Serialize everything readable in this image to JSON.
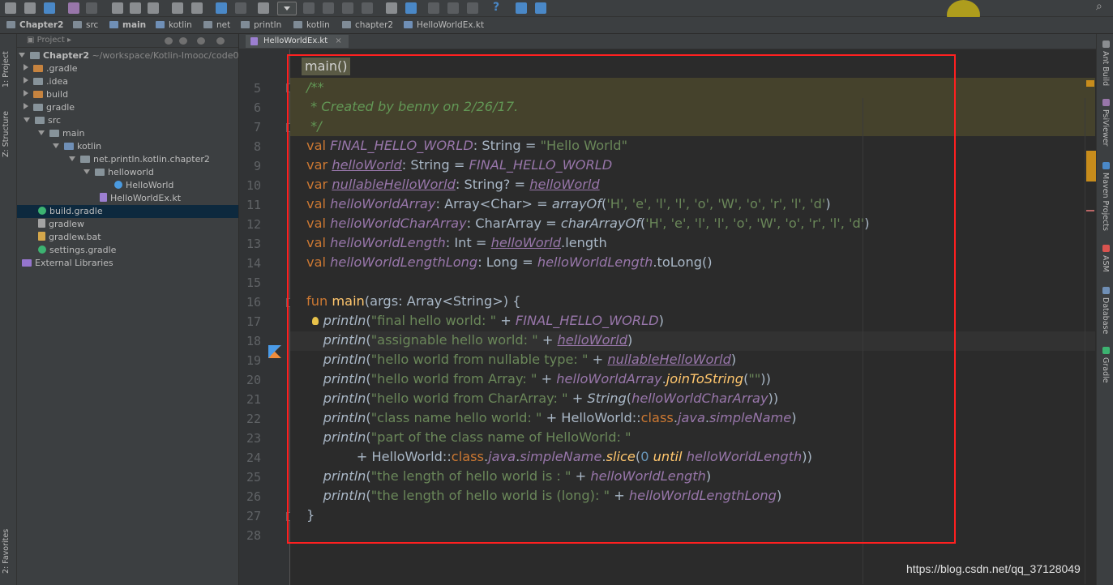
{
  "breadcrumbs": [
    "Chapter2",
    "src",
    "main",
    "kotlin",
    "net",
    "println",
    "kotlin",
    "chapter2",
    "HelloWorldEx.kt"
  ],
  "left_tool_tabs": [
    "1: Project",
    "Z: Structure",
    "2: Favorites"
  ],
  "right_tool_tabs": [
    "Ant Build",
    "PsiViewer",
    "Maven Projects",
    "ASM",
    "Database",
    "Gradle"
  ],
  "project_panel": {
    "title": "Project",
    "root_name": "Chapter2",
    "root_path": "~/workspace/Kotlin-Imooc/code0",
    "items": [
      {
        "label": ".gradle"
      },
      {
        "label": ".idea"
      },
      {
        "label": "build"
      },
      {
        "label": "gradle"
      },
      {
        "label": "src"
      },
      {
        "label": "main"
      },
      {
        "label": "kotlin"
      },
      {
        "label": "net.println.kotlin.chapter2"
      },
      {
        "label": "helloworld"
      },
      {
        "label": "HelloWorld"
      },
      {
        "label": "HelloWorldEx.kt"
      },
      {
        "label": "build.gradle"
      },
      {
        "label": "gradlew"
      },
      {
        "label": "gradlew.bat"
      },
      {
        "label": "settings.gradle"
      },
      {
        "label": "External Libraries"
      }
    ]
  },
  "editor": {
    "tab_label": "HelloWorldEx.kt",
    "tab_close": "×",
    "sticky_header": "main()",
    "line_numbers": [
      "5",
      "6",
      "7",
      "8",
      "9",
      "10",
      "11",
      "12",
      "13",
      "14",
      "15",
      "16",
      "17",
      "18",
      "19",
      "20",
      "21",
      "22",
      "23",
      "24",
      "25",
      "26",
      "27",
      "28"
    ]
  },
  "code_tokens": {
    "c_open": "/**",
    "c_body": " * Created by benny on 2/26/17.",
    "c_close": " */",
    "val": "val",
    "var": "var",
    "fun": "fun",
    "class": "class",
    "until": "until",
    "FINAL_HELLO_WORLD": "FINAL_HELLO_WORLD",
    "helloWorld": "helloWorld",
    "nullableHelloWorld": "nullableHelloWorld",
    "helloWorldArray": "helloWorldArray",
    "helloWorldCharArray": "helloWorldCharArray",
    "helloWorldLength": "helloWorldLength",
    "helloWorldLengthLong": "helloWorldLengthLong",
    "l8_mid": ": String = ",
    "s_hello": "\"Hello World\"",
    "l9_mid": ": String = ",
    "l10_mid": ": String? = ",
    "l11_mid": ": Array<Char> = ",
    "arrayOf": "arrayOf",
    "l12_mid": ": CharArray = ",
    "charArrayOf": "charArrayOf",
    "chars_open": "(",
    "chars_list": "'H', 'e', 'l', 'l', 'o', 'W', 'o', 'r', 'l', 'd'",
    "chars_close": ")",
    "l13_mid": ": Int = ",
    "l13_tail": ".length",
    "l14_mid": ": Long = ",
    "l14_tail": ".toLong()",
    "main": "main",
    "main_sig": "(args: Array<String>) {",
    "println": "println",
    "paren_open": "(",
    "plus": " + ",
    "paren_close": ")",
    "paren_close2": "))",
    "s17": "\"final hello world: \"",
    "s18": "\"assignable hello world: \"",
    "s19": "\"hello world from nullable type: \"",
    "s20": "\"hello world from Array: \"",
    "joinToString": "joinToString",
    "s20_arg": "\"\"",
    "s21": "\"hello world from CharArray: \"",
    "String": "String",
    "s22": "\"class name hello world: \"",
    "HelloWorld_ref": "HelloWorld::",
    "java": "java",
    "simpleName": "simpleName",
    "dot": ".",
    "s23": "\"part of the class name of HelloWorld: \"",
    "l24_lead": "+ HelloWorld::",
    "slice": "slice",
    "zero": "0",
    "s25": "\"the length of hello world is : \"",
    "s26": "\"the length of hello world is (long): \"",
    "close_brace": "}"
  },
  "watermark": "https://blog.csdn.net/qq_37128049"
}
